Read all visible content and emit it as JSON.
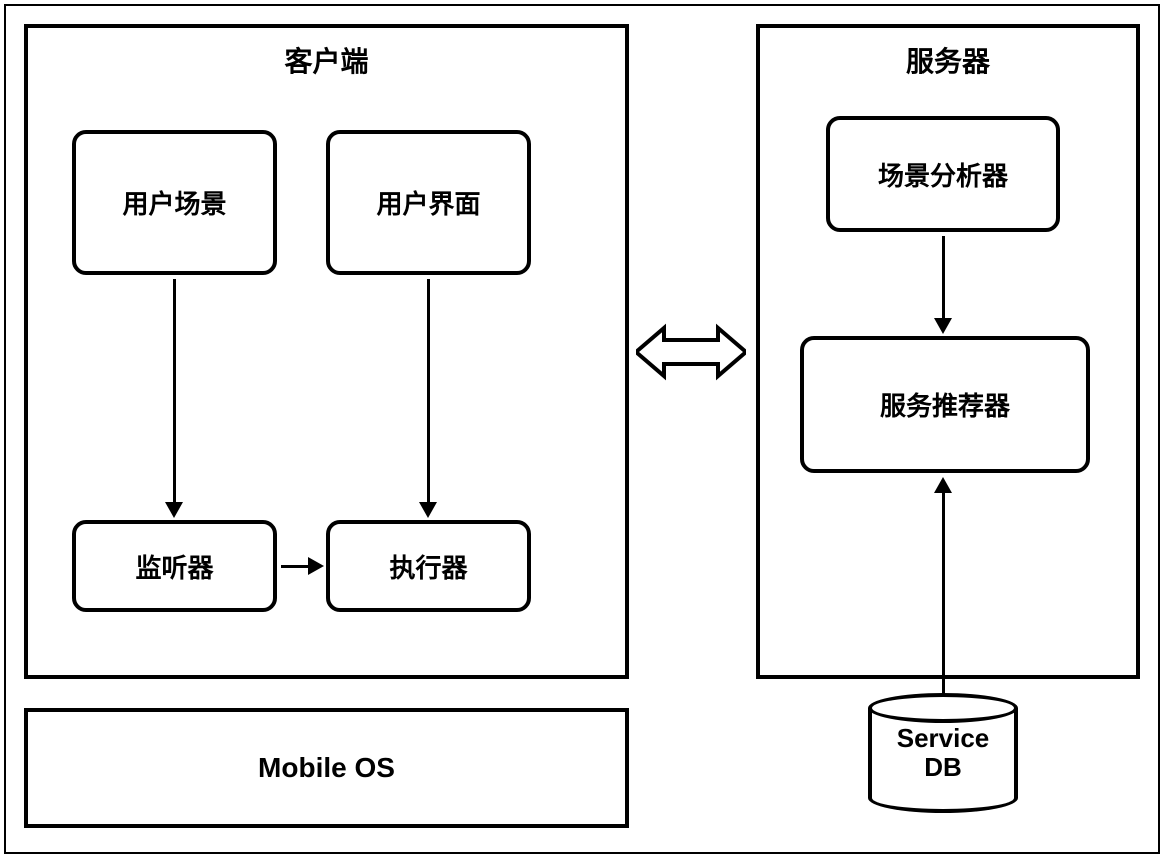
{
  "client": {
    "title": "客户端",
    "modules": {
      "user_scene": "用户场景",
      "user_interface": "用户界面",
      "listener": "监听器",
      "executor": "执行器"
    }
  },
  "mobile_os": "Mobile OS",
  "server": {
    "title": "服务器",
    "modules": {
      "scene_analyzer": "场景分析器",
      "service_recommender": "服务推荐器"
    },
    "database": {
      "line1": "Service",
      "line2": "DB"
    }
  }
}
